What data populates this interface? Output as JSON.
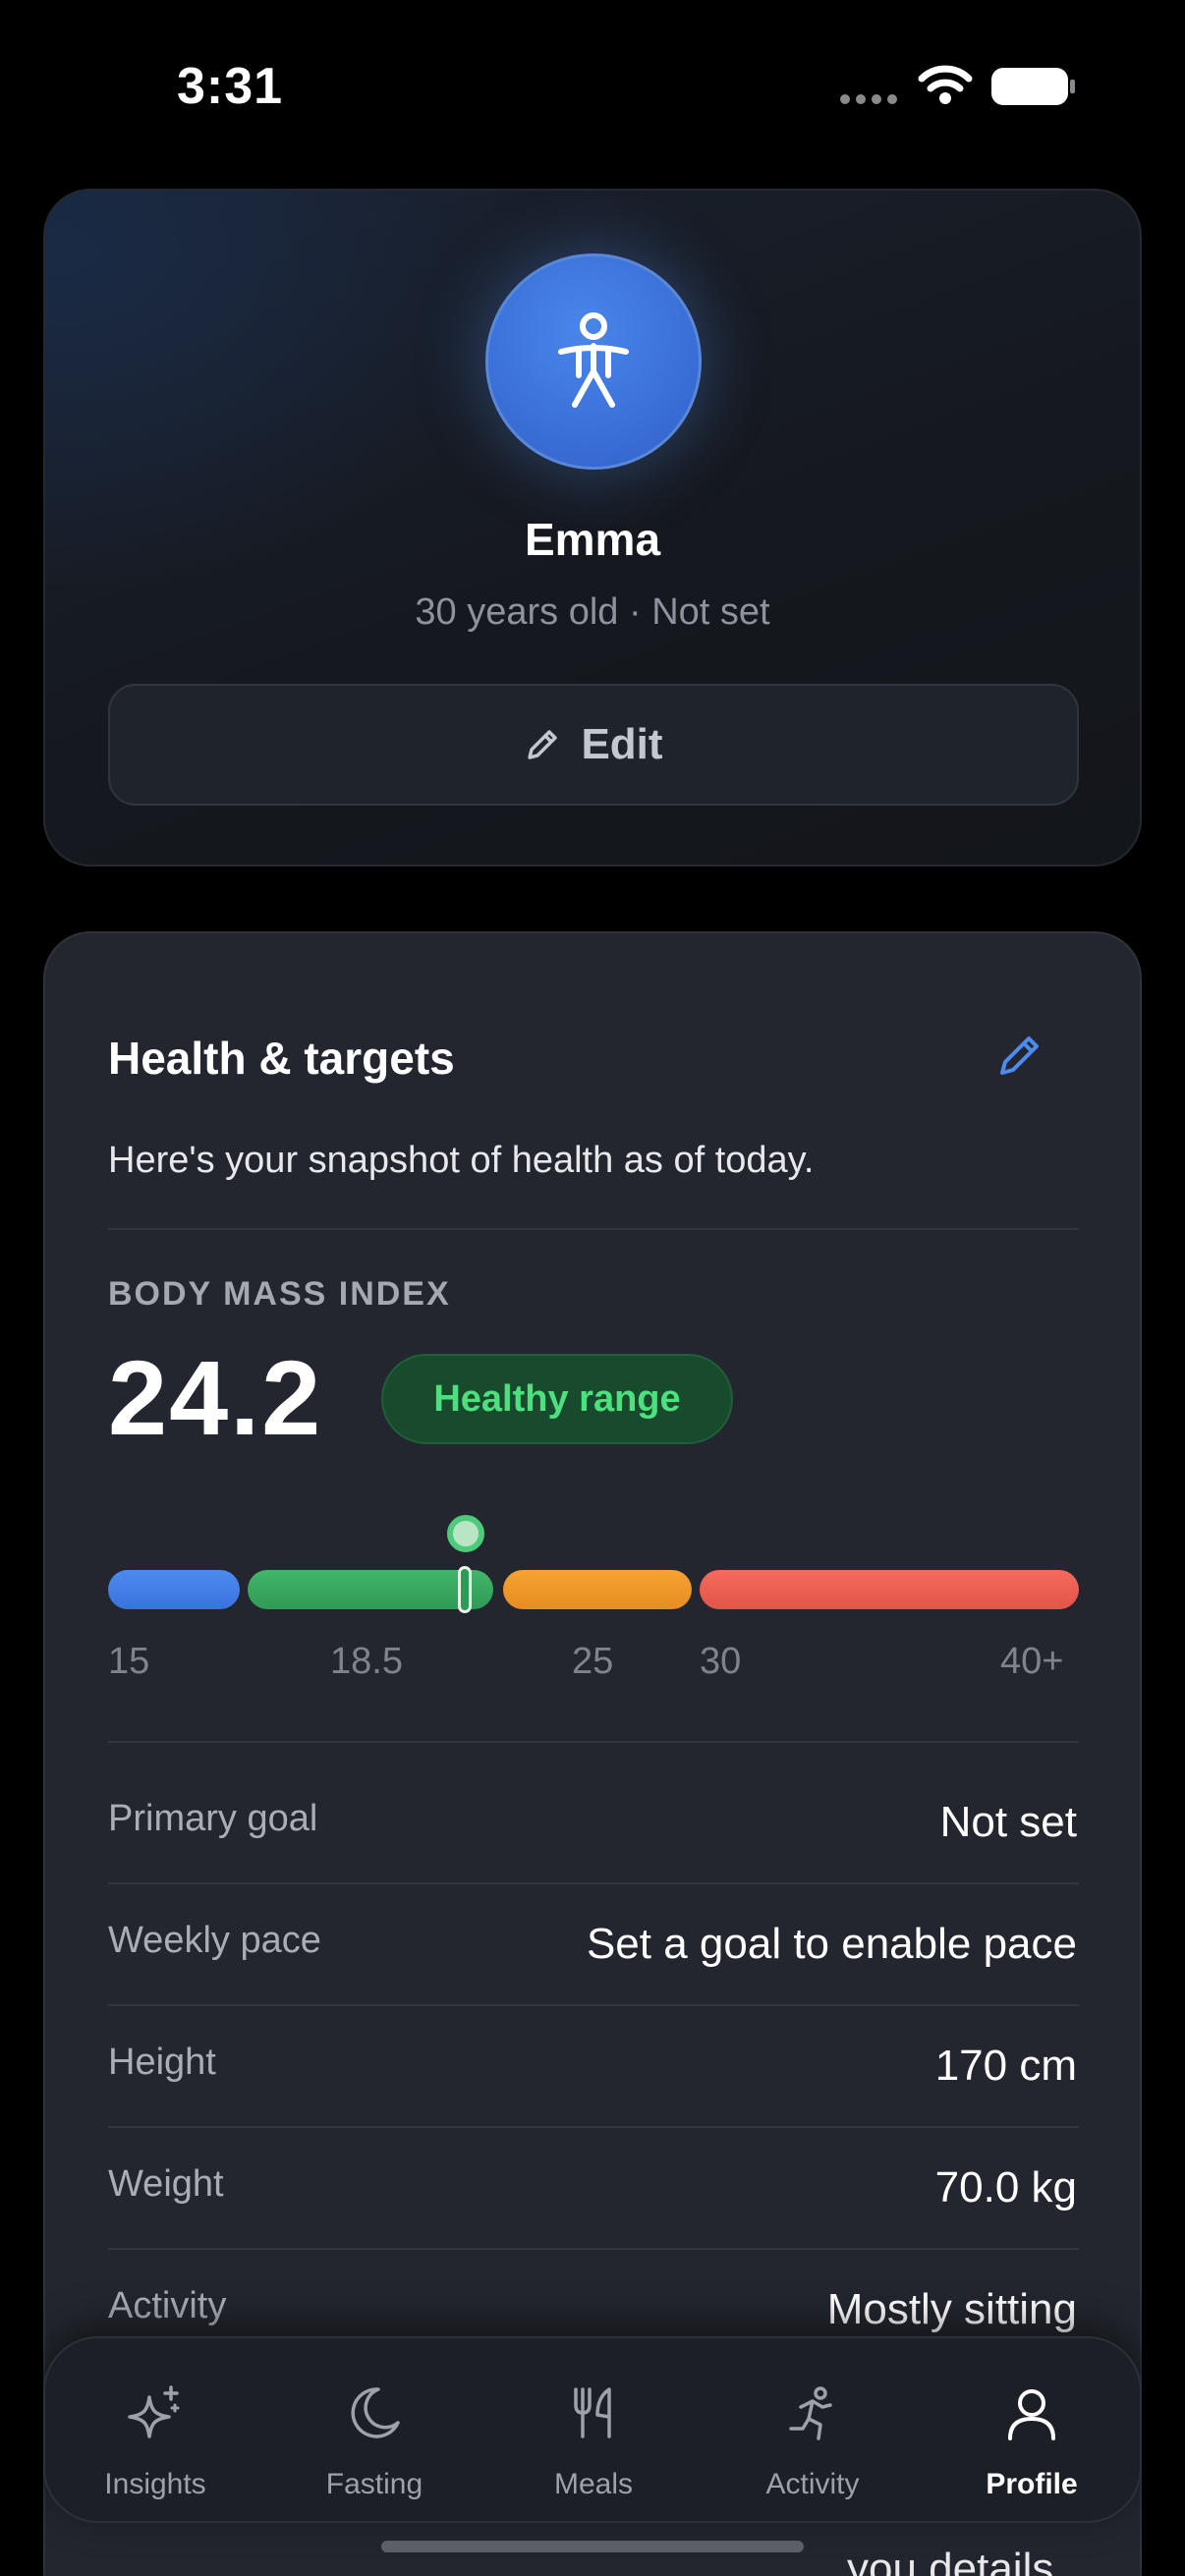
{
  "status_bar": {
    "time": "3:31"
  },
  "profile": {
    "name": "Emma",
    "subtitle": "30 years old · Not set",
    "edit_label": "Edit"
  },
  "health": {
    "title": "Health & targets",
    "description": "Here's your snapshot of health as of today.",
    "bmi_label": "BODY MASS INDEX",
    "bmi_value": "24.2",
    "bmi_badge": "Healthy range",
    "scale_ticks": [
      "15",
      "18.5",
      "25",
      "30",
      "40+"
    ],
    "rows": [
      {
        "label": "Primary goal",
        "value": "Not set"
      },
      {
        "label": "Weekly pace",
        "value": "Set a goal to enable pace"
      },
      {
        "label": "Height",
        "value": "170 cm"
      },
      {
        "label": "Weight",
        "value": "70.0 kg"
      },
      {
        "label": "Activity",
        "value": "Mostly sitting"
      }
    ],
    "peek_text": "you details"
  },
  "tabs": [
    {
      "label": "Insights",
      "icon": "sparkles-icon"
    },
    {
      "label": "Fasting",
      "icon": "moon-icon"
    },
    {
      "label": "Meals",
      "icon": "fork-knife-icon"
    },
    {
      "label": "Activity",
      "icon": "running-icon"
    },
    {
      "label": "Profile",
      "icon": "person-icon",
      "active": true
    }
  ],
  "colors": {
    "accent": "#3f7de6",
    "healthy": "#4ee07e",
    "underweight": "#4d8bf0",
    "overweight": "#f7a234",
    "obese": "#f46a5c"
  }
}
